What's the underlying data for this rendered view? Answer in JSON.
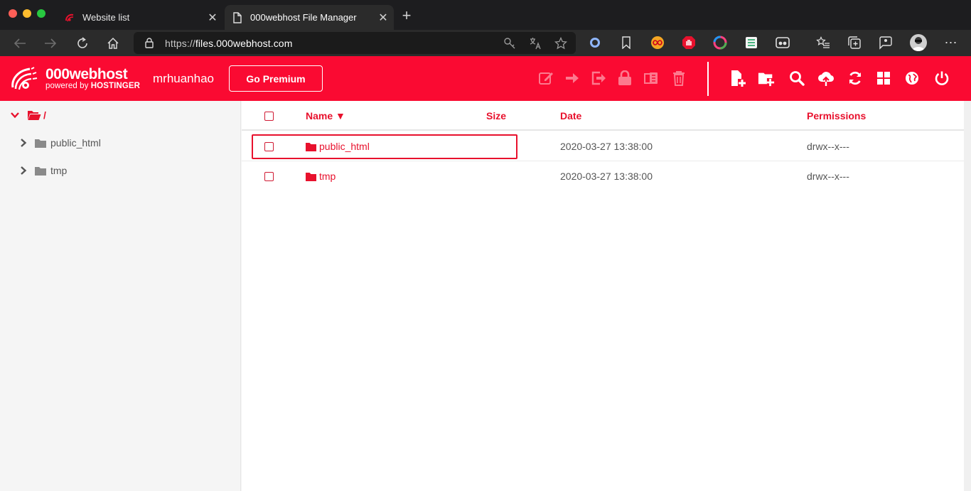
{
  "browser": {
    "tabs": [
      {
        "title": "Website list",
        "active": false
      },
      {
        "title": "000webhost File Manager",
        "active": true
      }
    ],
    "url_protocol": "https://",
    "url_host": "files.000webhost.com",
    "traffic_colors": [
      "#ff5f57",
      "#febc2e",
      "#28c840"
    ]
  },
  "header": {
    "brand_name": "000webhost",
    "brand_powered": "powered by",
    "brand_company": "HOSTINGER",
    "username": "mrhuanhao",
    "premium_label": "Go Premium",
    "accent_color": "#fa0a32",
    "disabled_actions": [
      "edit-icon",
      "move-icon",
      "export-icon",
      "lock-icon",
      "extract-icon",
      "trash-icon"
    ],
    "actions": [
      "new-file-icon",
      "new-folder-icon",
      "search-icon",
      "upload-icon",
      "refresh-icon",
      "grid-view-icon",
      "globe-icon",
      "power-icon"
    ]
  },
  "sidebar": {
    "root_label": "/",
    "items": [
      {
        "label": "public_html"
      },
      {
        "label": "tmp"
      }
    ]
  },
  "table": {
    "headers": {
      "name": "Name ▼",
      "size": "Size",
      "date": "Date",
      "permissions": "Permissions"
    },
    "rows": [
      {
        "name": "public_html",
        "date": "2020-03-27 13:38:00",
        "permissions": "drwx--x---",
        "highlighted": true
      },
      {
        "name": "tmp",
        "date": "2020-03-27 13:38:00",
        "permissions": "drwx--x---",
        "highlighted": false
      }
    ]
  }
}
